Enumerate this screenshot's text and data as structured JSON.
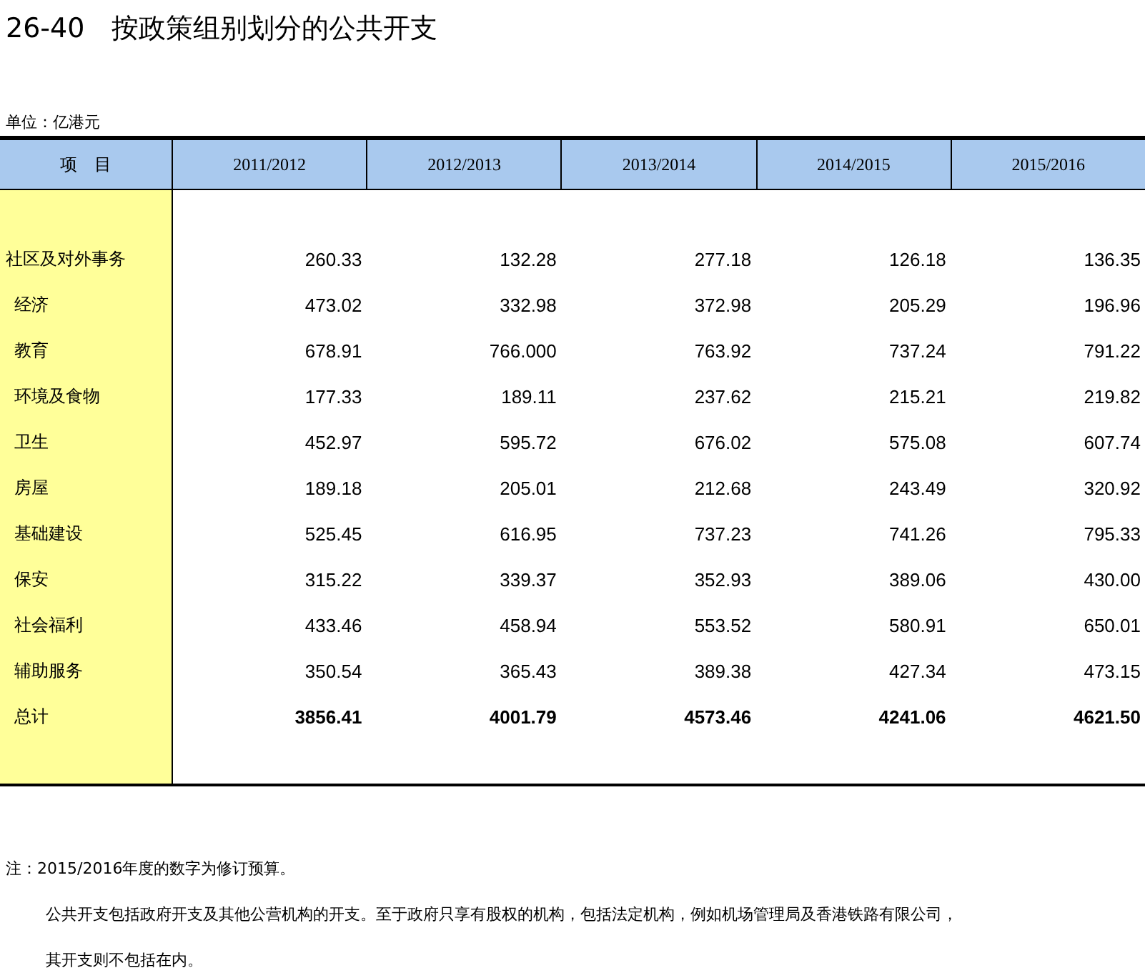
{
  "title": "26-40　按政策组别划分的公共开支",
  "unit": "单位：亿港元",
  "table": {
    "columns": [
      "项　目",
      "2011/2012",
      "2012/2013",
      "2013/2014",
      "2014/2015",
      "2015/2016"
    ],
    "rows": [
      {
        "label": "社区及对外事务",
        "indented": false,
        "kind": "item",
        "values": [
          "260.33",
          "132.28",
          "277.18",
          "126.18",
          "136.35"
        ]
      },
      {
        "label": "经济",
        "indented": true,
        "kind": "item",
        "values": [
          "473.02",
          "332.98",
          "372.98",
          "205.29",
          "196.96"
        ]
      },
      {
        "label": "教育",
        "indented": true,
        "kind": "item",
        "values": [
          "678.91",
          "766.000",
          "763.92",
          "737.24",
          "791.22"
        ]
      },
      {
        "label": "环境及食物",
        "indented": true,
        "kind": "item",
        "values": [
          "177.33",
          "189.11",
          "237.62",
          "215.21",
          "219.82"
        ]
      },
      {
        "label": "卫生",
        "indented": true,
        "kind": "item",
        "values": [
          "452.97",
          "595.72",
          "676.02",
          "575.08",
          "607.74"
        ]
      },
      {
        "label": "房屋",
        "indented": true,
        "kind": "item",
        "values": [
          "189.18",
          "205.01",
          "212.68",
          "243.49",
          "320.92"
        ]
      },
      {
        "label": "基础建设",
        "indented": true,
        "kind": "item",
        "values": [
          "525.45",
          "616.95",
          "737.23",
          "741.26",
          "795.33"
        ]
      },
      {
        "label": "保安",
        "indented": true,
        "kind": "item",
        "values": [
          "315.22",
          "339.37",
          "352.93",
          "389.06",
          "430.00"
        ]
      },
      {
        "label": "社会福利",
        "indented": true,
        "kind": "item",
        "values": [
          "433.46",
          "458.94",
          "553.52",
          "580.91",
          "650.01"
        ]
      },
      {
        "label": "辅助服务",
        "indented": true,
        "kind": "item",
        "values": [
          "350.54",
          "365.43",
          "389.38",
          "427.34",
          "473.15"
        ]
      },
      {
        "label": "总计",
        "indented": true,
        "kind": "total",
        "values": [
          "3856.41",
          "4001.79",
          "4573.46",
          "4241.06",
          "4621.50"
        ]
      }
    ]
  },
  "notes": [
    "注：2015/2016年度的数字为修订预算。",
    "公共开支包括政府开支及其他公营机构的开支。至于政府只享有股权的机构，包括法定机构，例如机场管理局及香港铁路有限公司，",
    "其开支则不包括在内。"
  ]
}
